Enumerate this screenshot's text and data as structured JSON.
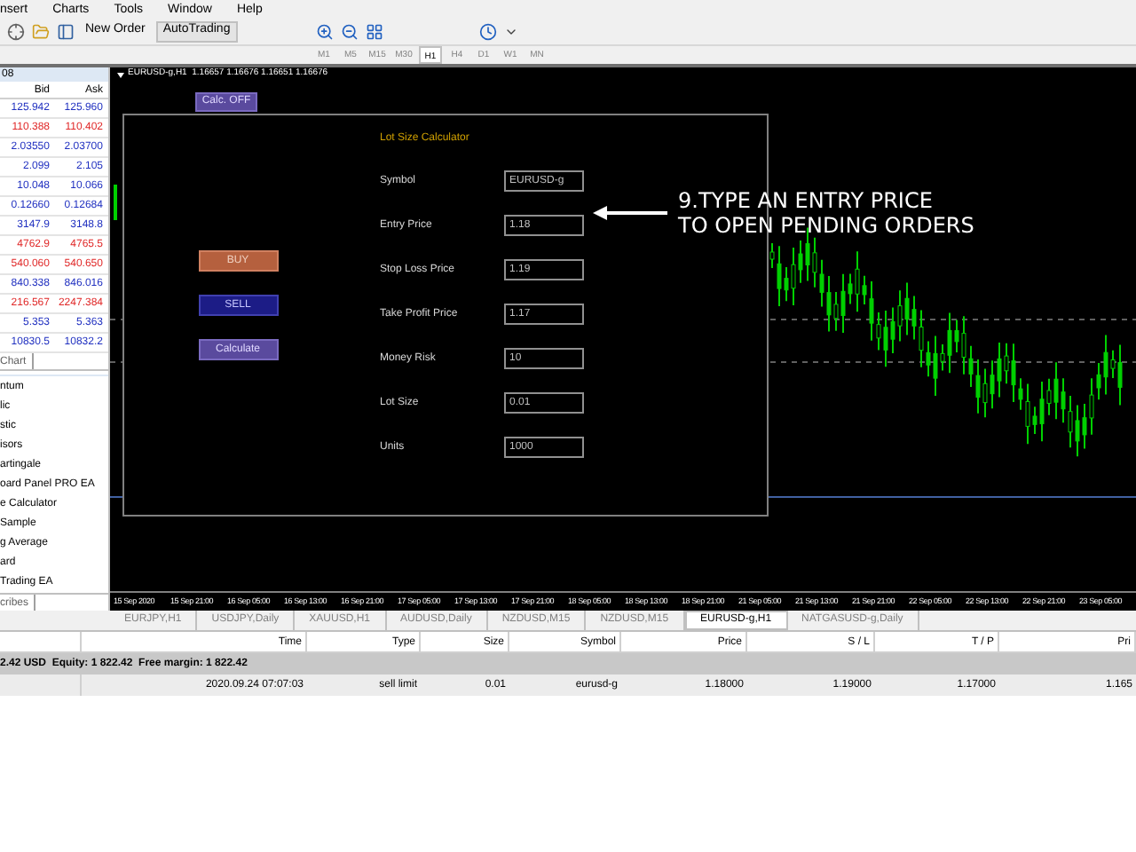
{
  "menu": [
    "nsert",
    "Charts",
    "Tools",
    "Window",
    "Help"
  ],
  "toolbar": {
    "new_order": "New Order",
    "autotrading": "AutoTrading"
  },
  "timeframes": [
    {
      "label": "M1",
      "selected": false
    },
    {
      "label": "M5",
      "selected": false
    },
    {
      "label": "M15",
      "selected": false
    },
    {
      "label": "M30",
      "selected": false
    },
    {
      "label": "H1",
      "selected": true
    },
    {
      "label": "H4",
      "selected": false
    },
    {
      "label": "D1",
      "selected": false
    },
    {
      "label": "W1",
      "selected": false
    },
    {
      "label": "MN",
      "selected": false
    }
  ],
  "market_watch": {
    "title": "08",
    "columns": [
      "Bid",
      "Ask"
    ],
    "rows": [
      {
        "bid": "125.942",
        "ask": "125.960",
        "color": "#2030c0"
      },
      {
        "bid": "110.388",
        "ask": "110.402",
        "color": "#e02828"
      },
      {
        "bid": "2.03550",
        "ask": "2.03700",
        "color": "#2030c0"
      },
      {
        "bid": "2.099",
        "ask": "2.105",
        "color": "#2030c0"
      },
      {
        "bid": "10.048",
        "ask": "10.066",
        "color": "#2030c0"
      },
      {
        "bid": "0.12660",
        "ask": "0.12684",
        "color": "#2030c0"
      },
      {
        "bid": "3147.9",
        "ask": "3148.8",
        "color": "#2030c0"
      },
      {
        "bid": "4762.9",
        "ask": "4765.5",
        "color": "#e02828"
      },
      {
        "bid": "540.060",
        "ask": "540.650",
        "color": "#e02828"
      },
      {
        "bid": "840.338",
        "ask": "846.016",
        "color": "#2030c0"
      },
      {
        "bid": "216.567",
        "ask": "2247.384",
        "color": "#e02828"
      },
      {
        "bid": "5.353",
        "ask": "5.363",
        "color": "#2030c0"
      },
      {
        "bid": "10830.5",
        "ask": "10832.2",
        "color": "#2030c0"
      }
    ],
    "tab": "Chart"
  },
  "navigator": {
    "items": [
      "ntum",
      "lic",
      "stic",
      "isors",
      "artingale",
      "oard Panel PRO EA",
      "e Calculator",
      "Sample",
      "g Average",
      "ard",
      "Trading EA"
    ],
    "tab": "cribes"
  },
  "chart": {
    "header": "EURUSD-g,H1  1.16657 1.16676 1.16651 1.16676",
    "time_labels": [
      "15 Sep 2020",
      "15 Sep 21:00",
      "16 Sep 05:00",
      "16 Sep 13:00",
      "16 Sep 21:00",
      "17 Sep 05:00",
      "17 Sep 13:00",
      "17 Sep 21:00",
      "18 Sep 05:00",
      "18 Sep 13:00",
      "18 Sep 21:00",
      "21 Sep 05:00",
      "21 Sep 13:00",
      "21 Sep 21:00",
      "22 Sep 05:00",
      "22 Sep 13:00",
      "22 Sep 21:00",
      "23 Sep 05:00"
    ]
  },
  "calculator": {
    "toggle_button": "Calc. OFF",
    "title": "Lot Size Calculator",
    "buttons": [
      {
        "kind": "buy",
        "label": "BUY"
      },
      {
        "kind": "sell",
        "label": "SELL"
      },
      {
        "kind": "calculate",
        "label": "Calculate"
      }
    ],
    "fields": [
      {
        "label": "Symbol",
        "value": "EURUSD-g"
      },
      {
        "label": "Entry Price",
        "value": "1.18"
      },
      {
        "label": "Stop Loss Price",
        "value": "1.19"
      },
      {
        "label": "Take Profit Price",
        "value": "1.17"
      },
      {
        "label": "Money Risk",
        "value": "10"
      },
      {
        "label": "Lot Size",
        "value": "0.01"
      },
      {
        "label": "Units",
        "value": "1000"
      }
    ]
  },
  "annotation": [
    "9.TYPE AN ENTRY PRICE",
    "TO OPEN PENDING ORDERS"
  ],
  "chart_tabs": [
    {
      "label": "EURJPY,H1",
      "selected": false
    },
    {
      "label": "USDJPY,Daily",
      "selected": false
    },
    {
      "label": "XAUUSD,H1",
      "selected": false
    },
    {
      "label": "AUDUSD,Daily",
      "selected": false
    },
    {
      "label": "NZDUSD,M15",
      "selected": false
    },
    {
      "label": "NZDUSD,M15",
      "selected": false
    },
    {
      "label": "EURUSD-g,H1",
      "selected": true
    },
    {
      "label": "NATGASUSD-g,Daily",
      "selected": false
    }
  ],
  "terminal": {
    "columns": [
      "",
      "Time",
      "Type",
      "Size",
      "Symbol",
      "Price",
      "S / L",
      "T / P",
      "Pri"
    ],
    "balance": "2.42 USD  Equity: 1 822.42  Free margin: 1 822.42",
    "rows": [
      [
        "",
        "2020.09.24 07:07:03",
        "sell limit",
        "0.01",
        "eurusd-g",
        "1.18000",
        "1.19000",
        "1.17000",
        "1.165"
      ]
    ]
  }
}
